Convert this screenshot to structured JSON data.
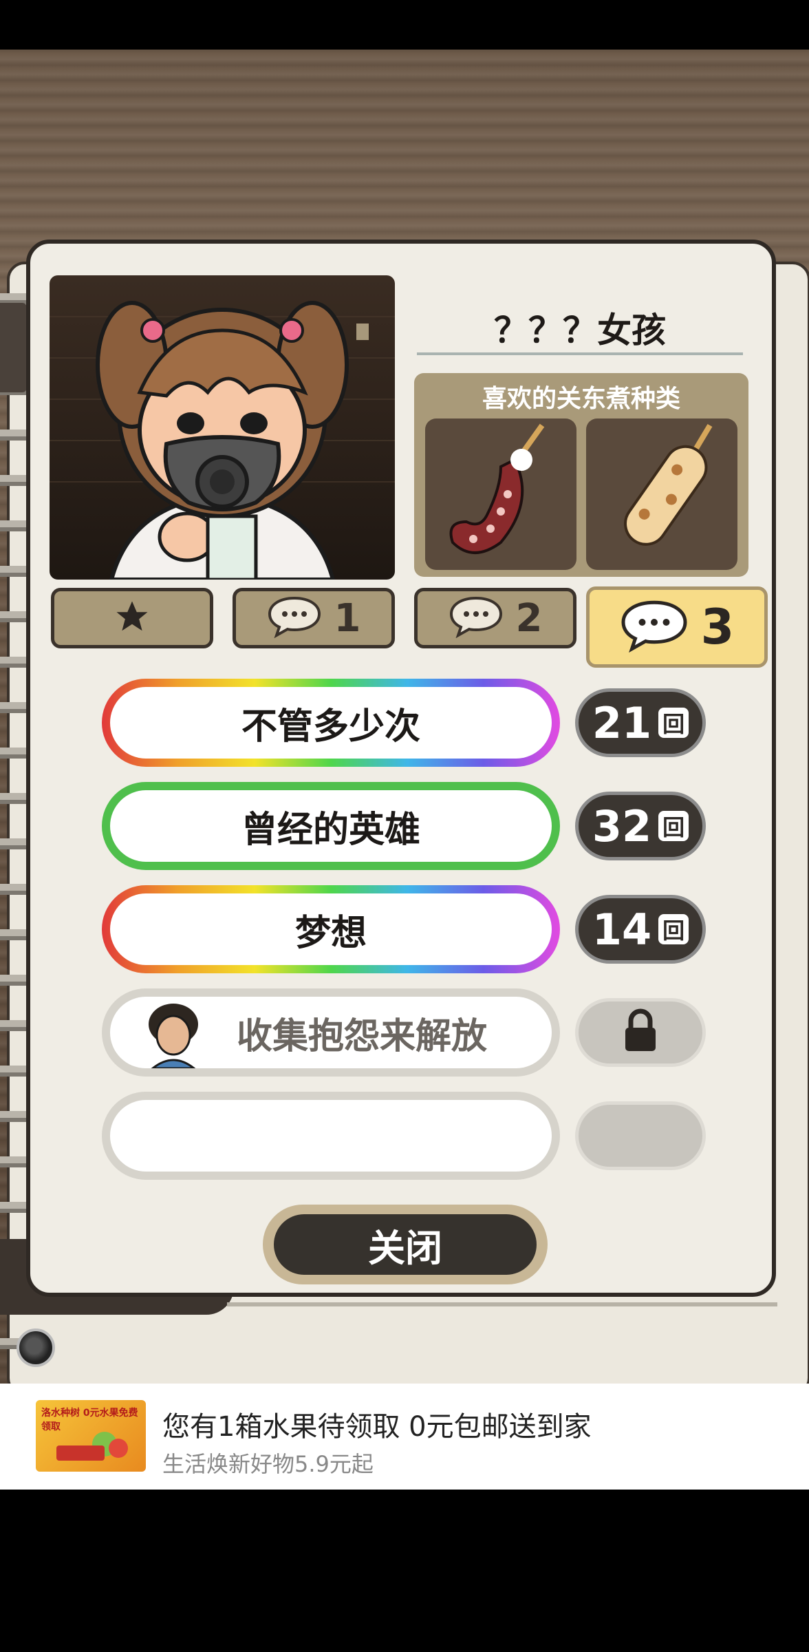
{
  "character": {
    "name": "？？？女孩",
    "favorite_title": "喜欢的关东煮种类",
    "favorites": [
      {
        "icon": "octopus-tentacle-skewer"
      },
      {
        "icon": "fish-cake-skewer"
      }
    ]
  },
  "tabs": [
    {
      "icon": "star-icon",
      "label": ""
    },
    {
      "icon": "speech-bubble-icon",
      "label": "1"
    },
    {
      "icon": "speech-bubble-icon",
      "label": "2"
    },
    {
      "icon": "speech-bubble-icon",
      "label": "3",
      "active": true
    }
  ],
  "stories": [
    {
      "title": "不管多少次",
      "count": "21",
      "unit": "回",
      "frame": "rainbow"
    },
    {
      "title": "曾经的英雄",
      "count": "32",
      "unit": "回",
      "frame": "green"
    },
    {
      "title": "梦想",
      "count": "14",
      "unit": "回",
      "frame": "rainbow"
    },
    {
      "title": "收集抱怨来解放",
      "locked": true
    },
    {
      "title": "",
      "locked": true
    }
  ],
  "close_label": "关闭",
  "ad": {
    "title": "您有1箱水果待领取 0元包邮送到家",
    "subtitle": "生活焕新好物5.9元起",
    "thumb_text": "洛水种树 0元水果免费领取"
  }
}
